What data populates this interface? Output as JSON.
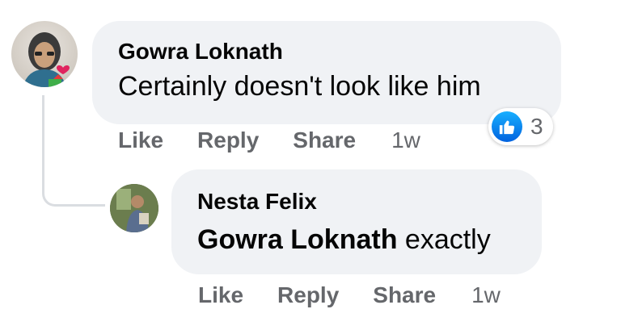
{
  "colors": {
    "bubble_bg": "#f0f2f5",
    "name_text": "#050505",
    "meta_text": "#65676b",
    "like_blue": "#1877f2",
    "thread_line": "#dadde1"
  },
  "comments": [
    {
      "author": "Gowra Loknath",
      "text": "Certainly doesn't look like him",
      "actions": {
        "like": "Like",
        "reply": "Reply",
        "share": "Share"
      },
      "timestamp": "1w",
      "reactions": {
        "icon": "like-thumb-icon",
        "count": "3"
      }
    }
  ],
  "replies": [
    {
      "author": "Nesta Felix",
      "mention": "Gowra Loknath",
      "text": " exactly",
      "actions": {
        "like": "Like",
        "reply": "Reply",
        "share": "Share"
      },
      "timestamp": "1w"
    }
  ]
}
